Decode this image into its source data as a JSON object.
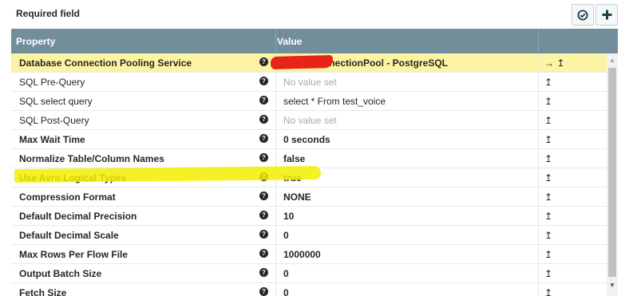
{
  "toolbar": {
    "required_label": "Required field",
    "verify_icon": "check-circle-icon",
    "add_icon": "plus-icon"
  },
  "table": {
    "columns": {
      "property": "Property",
      "value": "Value"
    },
    "rows": [
      {
        "name": "Database Connection Pooling Service",
        "value": "DBCPConnectionPool - PostgreSQL",
        "bold": true,
        "selected": true,
        "empty": false,
        "actions": "→ ↥"
      },
      {
        "name": "SQL Pre-Query",
        "value": "No value set",
        "bold": false,
        "selected": false,
        "empty": true,
        "actions": "↥"
      },
      {
        "name": "SQL select query",
        "value": "select * From test_voice",
        "bold": false,
        "selected": false,
        "empty": false,
        "actions": "↥"
      },
      {
        "name": "SQL Post-Query",
        "value": "No value set",
        "bold": false,
        "selected": false,
        "empty": true,
        "actions": "↥"
      },
      {
        "name": "Max Wait Time",
        "value": "0 seconds",
        "bold": true,
        "selected": false,
        "empty": false,
        "actions": "↥"
      },
      {
        "name": "Normalize Table/Column Names",
        "value": "false",
        "bold": true,
        "selected": false,
        "empty": false,
        "actions": "↥"
      },
      {
        "name": "Use Avro Logical Types",
        "value": "true",
        "bold": true,
        "selected": false,
        "empty": false,
        "actions": "↥"
      },
      {
        "name": "Compression Format",
        "value": "NONE",
        "bold": true,
        "selected": false,
        "empty": false,
        "actions": "↥"
      },
      {
        "name": "Default Decimal Precision",
        "value": "10",
        "bold": true,
        "selected": false,
        "empty": false,
        "actions": "↥"
      },
      {
        "name": "Default Decimal Scale",
        "value": "0",
        "bold": true,
        "selected": false,
        "empty": false,
        "actions": "↥"
      },
      {
        "name": "Max Rows Per Flow File",
        "value": "1000000",
        "bold": true,
        "selected": false,
        "empty": false,
        "actions": "↥"
      },
      {
        "name": "Output Batch Size",
        "value": "0",
        "bold": true,
        "selected": false,
        "empty": false,
        "actions": "↥"
      },
      {
        "name": "Fetch Size",
        "value": "0",
        "bold": true,
        "selected": false,
        "empty": false,
        "actions": "↥"
      }
    ]
  },
  "colors": {
    "header_bg": "#728e9b",
    "selected_row": "#fcf4a3",
    "annotation_highlight": "#f3ee00",
    "annotation_redaction": "#e8231b"
  }
}
